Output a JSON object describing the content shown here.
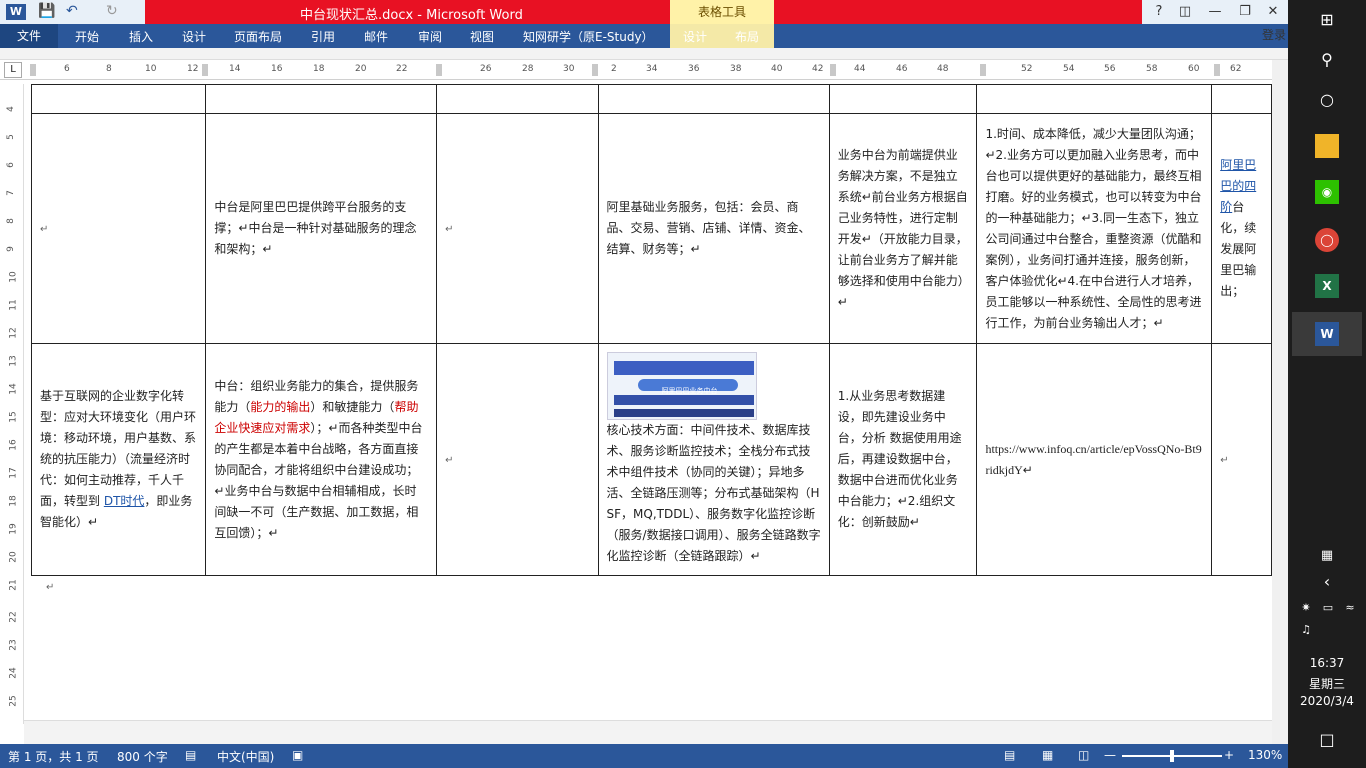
{
  "window": {
    "title": "中台现状汇总.docx - Microsoft Word",
    "context_tab": "表格工具",
    "help": "?",
    "login": "登录"
  },
  "ribbon": {
    "file": "文件",
    "tabs": [
      "开始",
      "插入",
      "设计",
      "页面布局",
      "引用",
      "邮件",
      "审阅",
      "视图",
      "知网研学（原E-Study）",
      "设计",
      "布局"
    ]
  },
  "ruler": {
    "numbers": [
      "6",
      "8",
      "10",
      "12",
      "14",
      "16",
      "18",
      "20",
      "22",
      "26",
      "28",
      "30",
      "2",
      "34",
      "36",
      "38",
      "40",
      "42",
      "44",
      "46",
      "48",
      "52",
      "54",
      "56",
      "58",
      "60",
      "62"
    ],
    "vertical": [
      "4",
      "5",
      "6",
      "7",
      "8",
      "9",
      "10",
      "11",
      "12",
      "13",
      "14",
      "15",
      "16",
      "17",
      "18",
      "19",
      "20",
      "21",
      "22",
      "23",
      "24",
      "25"
    ],
    "corner": "L"
  },
  "table": {
    "row1": {
      "c2": "中台是阿里巴巴提供跨平台服务的支撑；↵中台是一种针对基础服务的理念和架构；↵",
      "c4": "阿里基础业务服务，包括：会员、商品、交易、营销、店铺、详情、资金、结算、财务等；↵",
      "c5": "业务中台为前端提供业务解决方案，不是独立系统↵前台业务方根据自己业务特性，进行定制开发↵（开放能力目录，让前台业务方了解并能够选择和使用中台能力）↵",
      "c6": "1.时间、成本降低，减少大量团队沟通；↵2.业务方可以更加融入业务思考，而中台也可以提供更好的基础能力，最终互相打磨。好的业务模式，也可以转变为中台的一种基础能力；↵3.同一生态下，独立公司间通过中台整合，重整资源（优酷和案例），业务间打通并连接，服务创新，客户体验优化↵4.在中台进行人才培养，员工能够以一种系统性、全局性的思考进行工作，为前台业务输出人才；↵",
      "c7_link": "阿里巴巴的四阶",
      "c7_text": "台化，续发展阿里巴输出；"
    },
    "row2": {
      "c1_a": "基于互联网的企业数字化转型：应对大环境变化（用户环境：移动环境，用户基数、系统的抗压能力）（流量经济时代：如何主动推荐，千人千面，转型到 ",
      "c1_link": "DT时代",
      "c1_b": "，即业务智能化）↵",
      "c2_a": "中台：组织业务能力的集合，提供服务能力（",
      "c2_red1": "能力的输出",
      "c2_b": "）和敏捷能力（",
      "c2_red2": "帮助企业快速应对需求",
      "c2_c": "）；↵而各种类型中台的产生都是本着中台战略，各方面直接协同配合，才能将组织中台建设成功；↵业务中台与数据中台相辅相成，长时间缺一不可（生产数据、加工数据，相互回馈）；↵",
      "c4_img_caption": "阿里巴巴业务中台",
      "c4": "核心技术方面：中间件技术、数据库技术、服务诊断监控技术；全栈分布式技术中组件技术（协同的关键）；异地多活、全链路压测等；分布式基础架构（HSF，MQ,TDDL）、服务数字化监控诊断（服务/数据接口调用）、服务全链路数字化监控诊断（全链路跟踪）↵",
      "c5": "1.从业务思考数据建设，即先建设业务中台，分析 数据使用用途后，再建设数据中台，数据中台进而优化业务中台能力；↵2.组织文化：创新鼓励↵",
      "c6": "https://www.infoq.cn/article/epVossQNo-Bt9ridkjdY↵"
    },
    "para_mark": "↵"
  },
  "status": {
    "page": "第 1 页，共 1 页",
    "words": "800 个字",
    "lang": "中文(中国)",
    "zoom": "130%"
  },
  "taskbar": {
    "time": "16:37",
    "weekday": "星期三",
    "date": "2020/3/4"
  }
}
